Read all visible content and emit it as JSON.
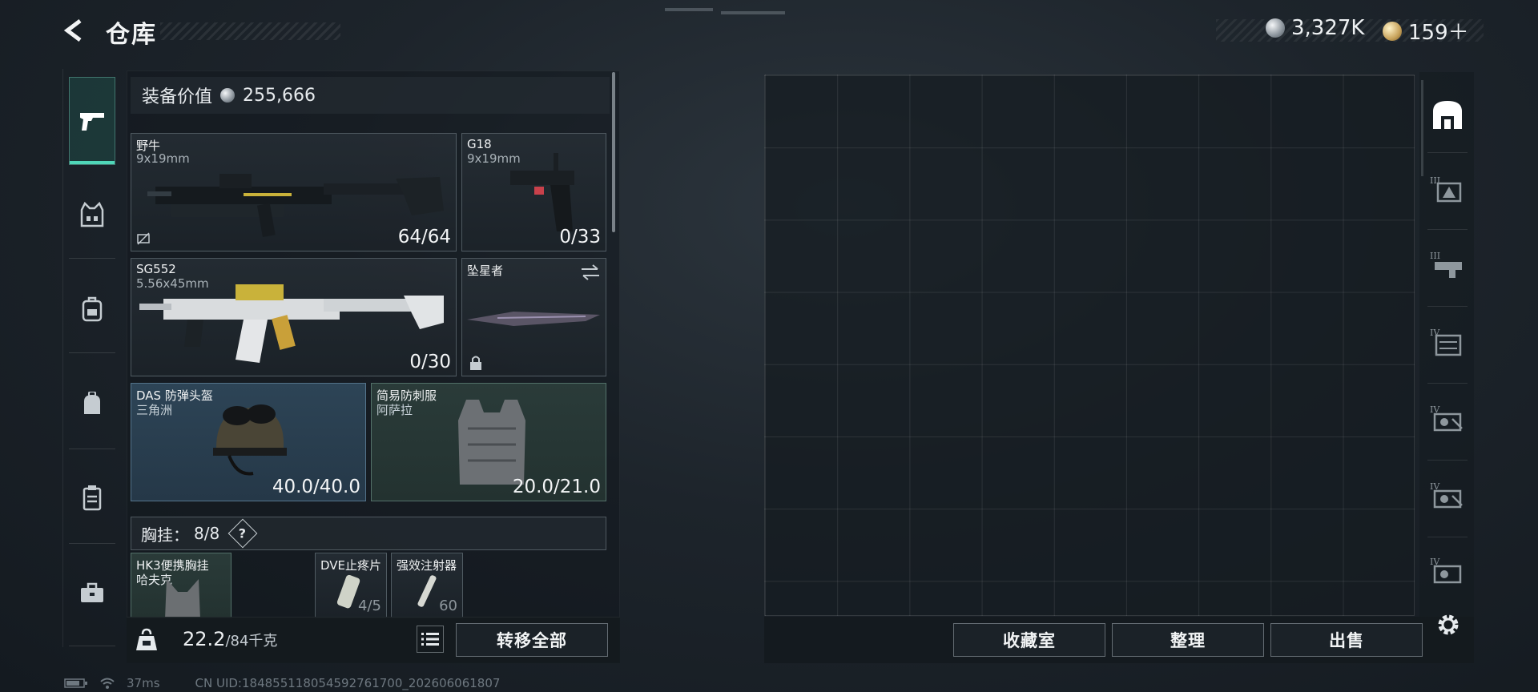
{
  "header": {
    "title": "仓库",
    "currency": [
      {
        "icon": "silver-coin-icon",
        "value": "3,327K"
      },
      {
        "icon": "gold-coin-icon",
        "value": "159＋"
      }
    ]
  },
  "left_tabs": [
    {
      "icon": "pistol-icon",
      "active": true
    },
    {
      "icon": "vest-icon",
      "active": false
    },
    {
      "icon": "backpack-icon",
      "active": false
    },
    {
      "icon": "bag-icon",
      "active": false
    },
    {
      "icon": "container-icon",
      "active": false
    },
    {
      "icon": "toolbox-icon",
      "active": false
    }
  ],
  "loadout": {
    "value_label": "装备价值",
    "value": "255,666",
    "weapons": [
      {
        "name": "野牛",
        "caliber": "9x19mm",
        "ammo": "64/64"
      },
      {
        "name": "G18",
        "caliber": "9x19mm",
        "ammo": "0/33"
      },
      {
        "name": "SG552",
        "caliber": "5.56x45mm",
        "ammo": "0/30"
      },
      {
        "name": "坠星者",
        "caliber": "",
        "ammo": ""
      }
    ],
    "armor": [
      {
        "name": "DAS 防弹头盔",
        "sub": "三角洲",
        "durability": "40.0/40.0"
      },
      {
        "name": "简易防刺服",
        "sub": "阿萨拉",
        "durability": "20.0/21.0"
      }
    ],
    "chest": {
      "label": "胸挂：",
      "value": "8/8",
      "help": "?"
    },
    "chest_items": [
      {
        "name": "HK3便携胸挂",
        "sub": "哈夫克"
      },
      {
        "name": "DVE止疼片",
        "sub": "",
        "count": "4/5"
      },
      {
        "name": "强效注射器",
        "sub": "",
        "count": "60"
      }
    ]
  },
  "bottom_left": {
    "weight": "22.2",
    "weight_max": "/84千克",
    "transfer_all": "转移全部"
  },
  "bottom_right": {
    "buttons": [
      "收藏室",
      "整理",
      "出售"
    ]
  },
  "right_rail": [
    {
      "icon": "stash-home-icon"
    },
    {
      "icon": "stash-tier3-a-icon",
      "tier": "III"
    },
    {
      "icon": "stash-tier3-b-icon",
      "tier": "III"
    },
    {
      "icon": "stash-tier4-a-icon",
      "tier": "IV"
    },
    {
      "icon": "stash-tier4-b-icon",
      "tier": "IV"
    },
    {
      "icon": "stash-tier4-c-icon",
      "tier": "IV"
    },
    {
      "icon": "stash-tier4-d-icon",
      "tier": "IV"
    }
  ],
  "status": {
    "ping": "37ms",
    "uid": "CN UID:1848551180545927617​00_202606061807"
  }
}
